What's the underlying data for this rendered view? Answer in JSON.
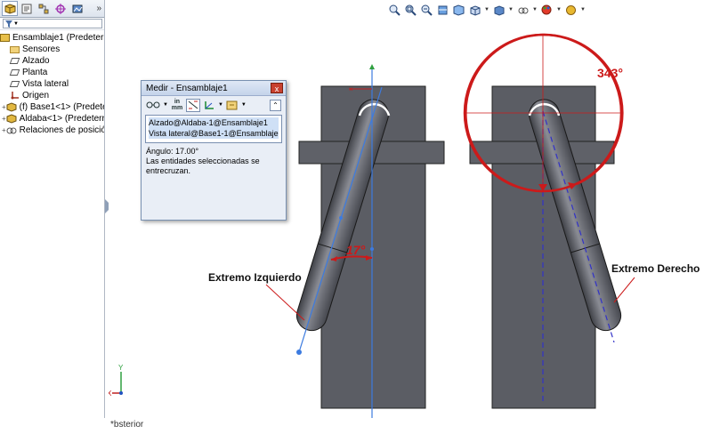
{
  "tree": {
    "expand_glyph": "»",
    "filter_icon": "filter-icon",
    "filter_glyph": "▼",
    "items": [
      {
        "label": "Ensamblaje1  (Predeterm",
        "icon": "assembly-icon",
        "expander": ""
      },
      {
        "label": "Sensores",
        "icon": "sensors-folder-icon",
        "expander": ""
      },
      {
        "label": "Alzado",
        "icon": "plane-icon",
        "expander": ""
      },
      {
        "label": "Planta",
        "icon": "plane-icon",
        "expander": ""
      },
      {
        "label": "Vista lateral",
        "icon": "plane-icon",
        "expander": ""
      },
      {
        "label": "Origen",
        "icon": "origin-icon",
        "expander": ""
      },
      {
        "label": "(f) Base1<1> (Predete",
        "icon": "part-icon",
        "expander": "+"
      },
      {
        "label": "Aldaba<1> (Predeterr",
        "icon": "part-icon",
        "expander": "+"
      },
      {
        "label": "Relaciones de posició",
        "icon": "mates-icon",
        "expander": "+"
      }
    ]
  },
  "measure": {
    "title": "Medir - Ensamblaje1",
    "close_glyph": "x",
    "units_top": "in",
    "units_bottom": "mm",
    "collapse_glyph": "⌃",
    "selection": [
      "Alzado@Aldaba-1@Ensamblaje1",
      "Vista lateral@Base1-1@Ensamblaje1"
    ],
    "angle": "Ángulo: 17.00°",
    "message_line1": "Las entidades seleccionadas se",
    "message_line2": "entrecruzan."
  },
  "annotations": {
    "angle_left": "17°",
    "angle_right": "343°",
    "label_left": "Extremo Izquierdo",
    "label_right": "Extremo Derecho"
  },
  "triad": {
    "x": "X",
    "y": "Y"
  },
  "status": {
    "text": "*bsterior"
  },
  "colors": {
    "base_plate": "#5b5d64",
    "latch": "#6e7078",
    "annotation_red": "#cc1a1a",
    "sketch_blue": "#3c7be0"
  }
}
